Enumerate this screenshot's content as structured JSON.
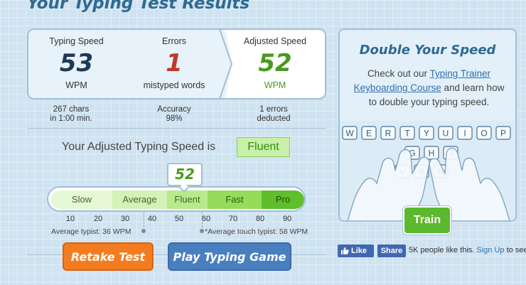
{
  "page": {
    "title": "Your Typing Test Results"
  },
  "stats": {
    "speed": {
      "label": "Typing Speed",
      "value": "53",
      "unit": "WPM"
    },
    "errors": {
      "label": "Errors",
      "value": "1",
      "unit": "mistyped words"
    },
    "adjusted": {
      "label": "Adjusted Speed",
      "value": "52",
      "unit": "WPM"
    }
  },
  "substats": {
    "chars_line1": "267 chars",
    "chars_line2": "in 1:00 min.",
    "accuracy_label": "Accuracy",
    "accuracy_value": "98%",
    "deducted_line1": "1 errors",
    "deducted_line2": "deducted"
  },
  "adjusted_line": {
    "text": "Your Adjusted Typing Speed is",
    "level": "Fluent"
  },
  "scale": {
    "marker_value": "52",
    "segments": [
      "Slow",
      "Average",
      "Fluent",
      "Fast",
      "Pro"
    ],
    "ticks": [
      "10",
      "20",
      "30",
      "40",
      "50",
      "60",
      "70",
      "80",
      "90"
    ],
    "average_typist": "Average typist: 36 WPM",
    "touch_typist": "*Average touch typist: 58 WPM"
  },
  "buttons": {
    "retake": "Retake Test",
    "play": "Play Typing Game",
    "train": "Train"
  },
  "promo": {
    "title": "Double Your Speed",
    "text_before": "Check out our",
    "link": "Typing Trainer Keyboarding Course",
    "text_after": "and learn how to double your typing speed.",
    "keys_row1": [
      "W",
      "E",
      "R",
      "T",
      "Y",
      "U",
      "I",
      "O",
      "P"
    ],
    "keys_row2": [
      "G",
      "H",
      "J"
    ],
    "keys_row3": [
      "V",
      "B",
      "N"
    ]
  },
  "social": {
    "like": "Like",
    "share": "Share",
    "text": "5K people like this.",
    "signup": "Sign Up",
    "after": "to see"
  },
  "colors": {
    "brand_blue": "#2f6a92",
    "error_red": "#c0392b",
    "adjusted_green": "#4a9a20",
    "retake_orange": "#f47c20",
    "play_blue": "#4a7fbf",
    "train_green": "#5cb82c",
    "facebook_blue": "#4267b2"
  }
}
